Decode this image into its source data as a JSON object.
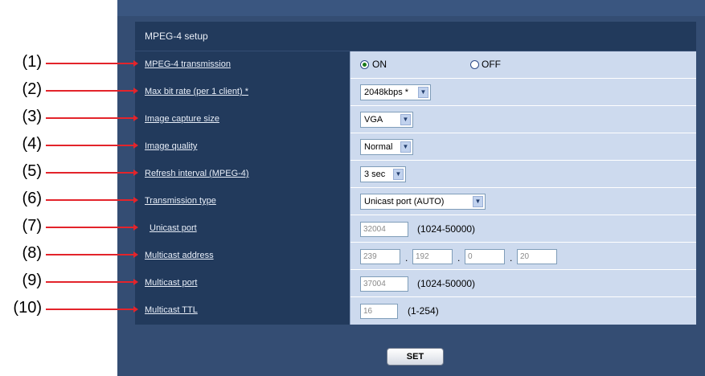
{
  "section_title": "MPEG-4 setup",
  "rows": [
    {
      "label": "MPEG-4 transmission"
    },
    {
      "label": "Max bit rate (per 1 client) *",
      "select": "2048kbps *"
    },
    {
      "label": "Image capture size",
      "select": "VGA"
    },
    {
      "label": "Image quality",
      "select": "Normal"
    },
    {
      "label": "Refresh interval (MPEG-4)",
      "select": "3 sec"
    },
    {
      "label": "Transmission type",
      "select": "Unicast port (AUTO)"
    },
    {
      "label": "Unicast port",
      "value": "32004",
      "hint": "(1024-50000)"
    },
    {
      "label": "Multicast address",
      "octets": [
        "239",
        "192",
        "0",
        "20"
      ]
    },
    {
      "label": "Multicast port",
      "value": "37004",
      "hint": "(1024-50000)"
    },
    {
      "label": "Multicast TTL",
      "value": "16",
      "hint": "(1-254)"
    }
  ],
  "transmission": {
    "on_label": "ON",
    "off_label": "OFF",
    "selected": "ON"
  },
  "callouts": [
    "(1)",
    "(2)",
    "(3)",
    "(4)",
    "(5)",
    "(6)",
    "(7)",
    "(8)",
    "(9)",
    "(10)"
  ],
  "set_button": "SET",
  "colors": {
    "panel": "#344d73",
    "label_cell": "#223a5c",
    "value_cell": "#cddaee",
    "callout_line": "#e3242b"
  }
}
